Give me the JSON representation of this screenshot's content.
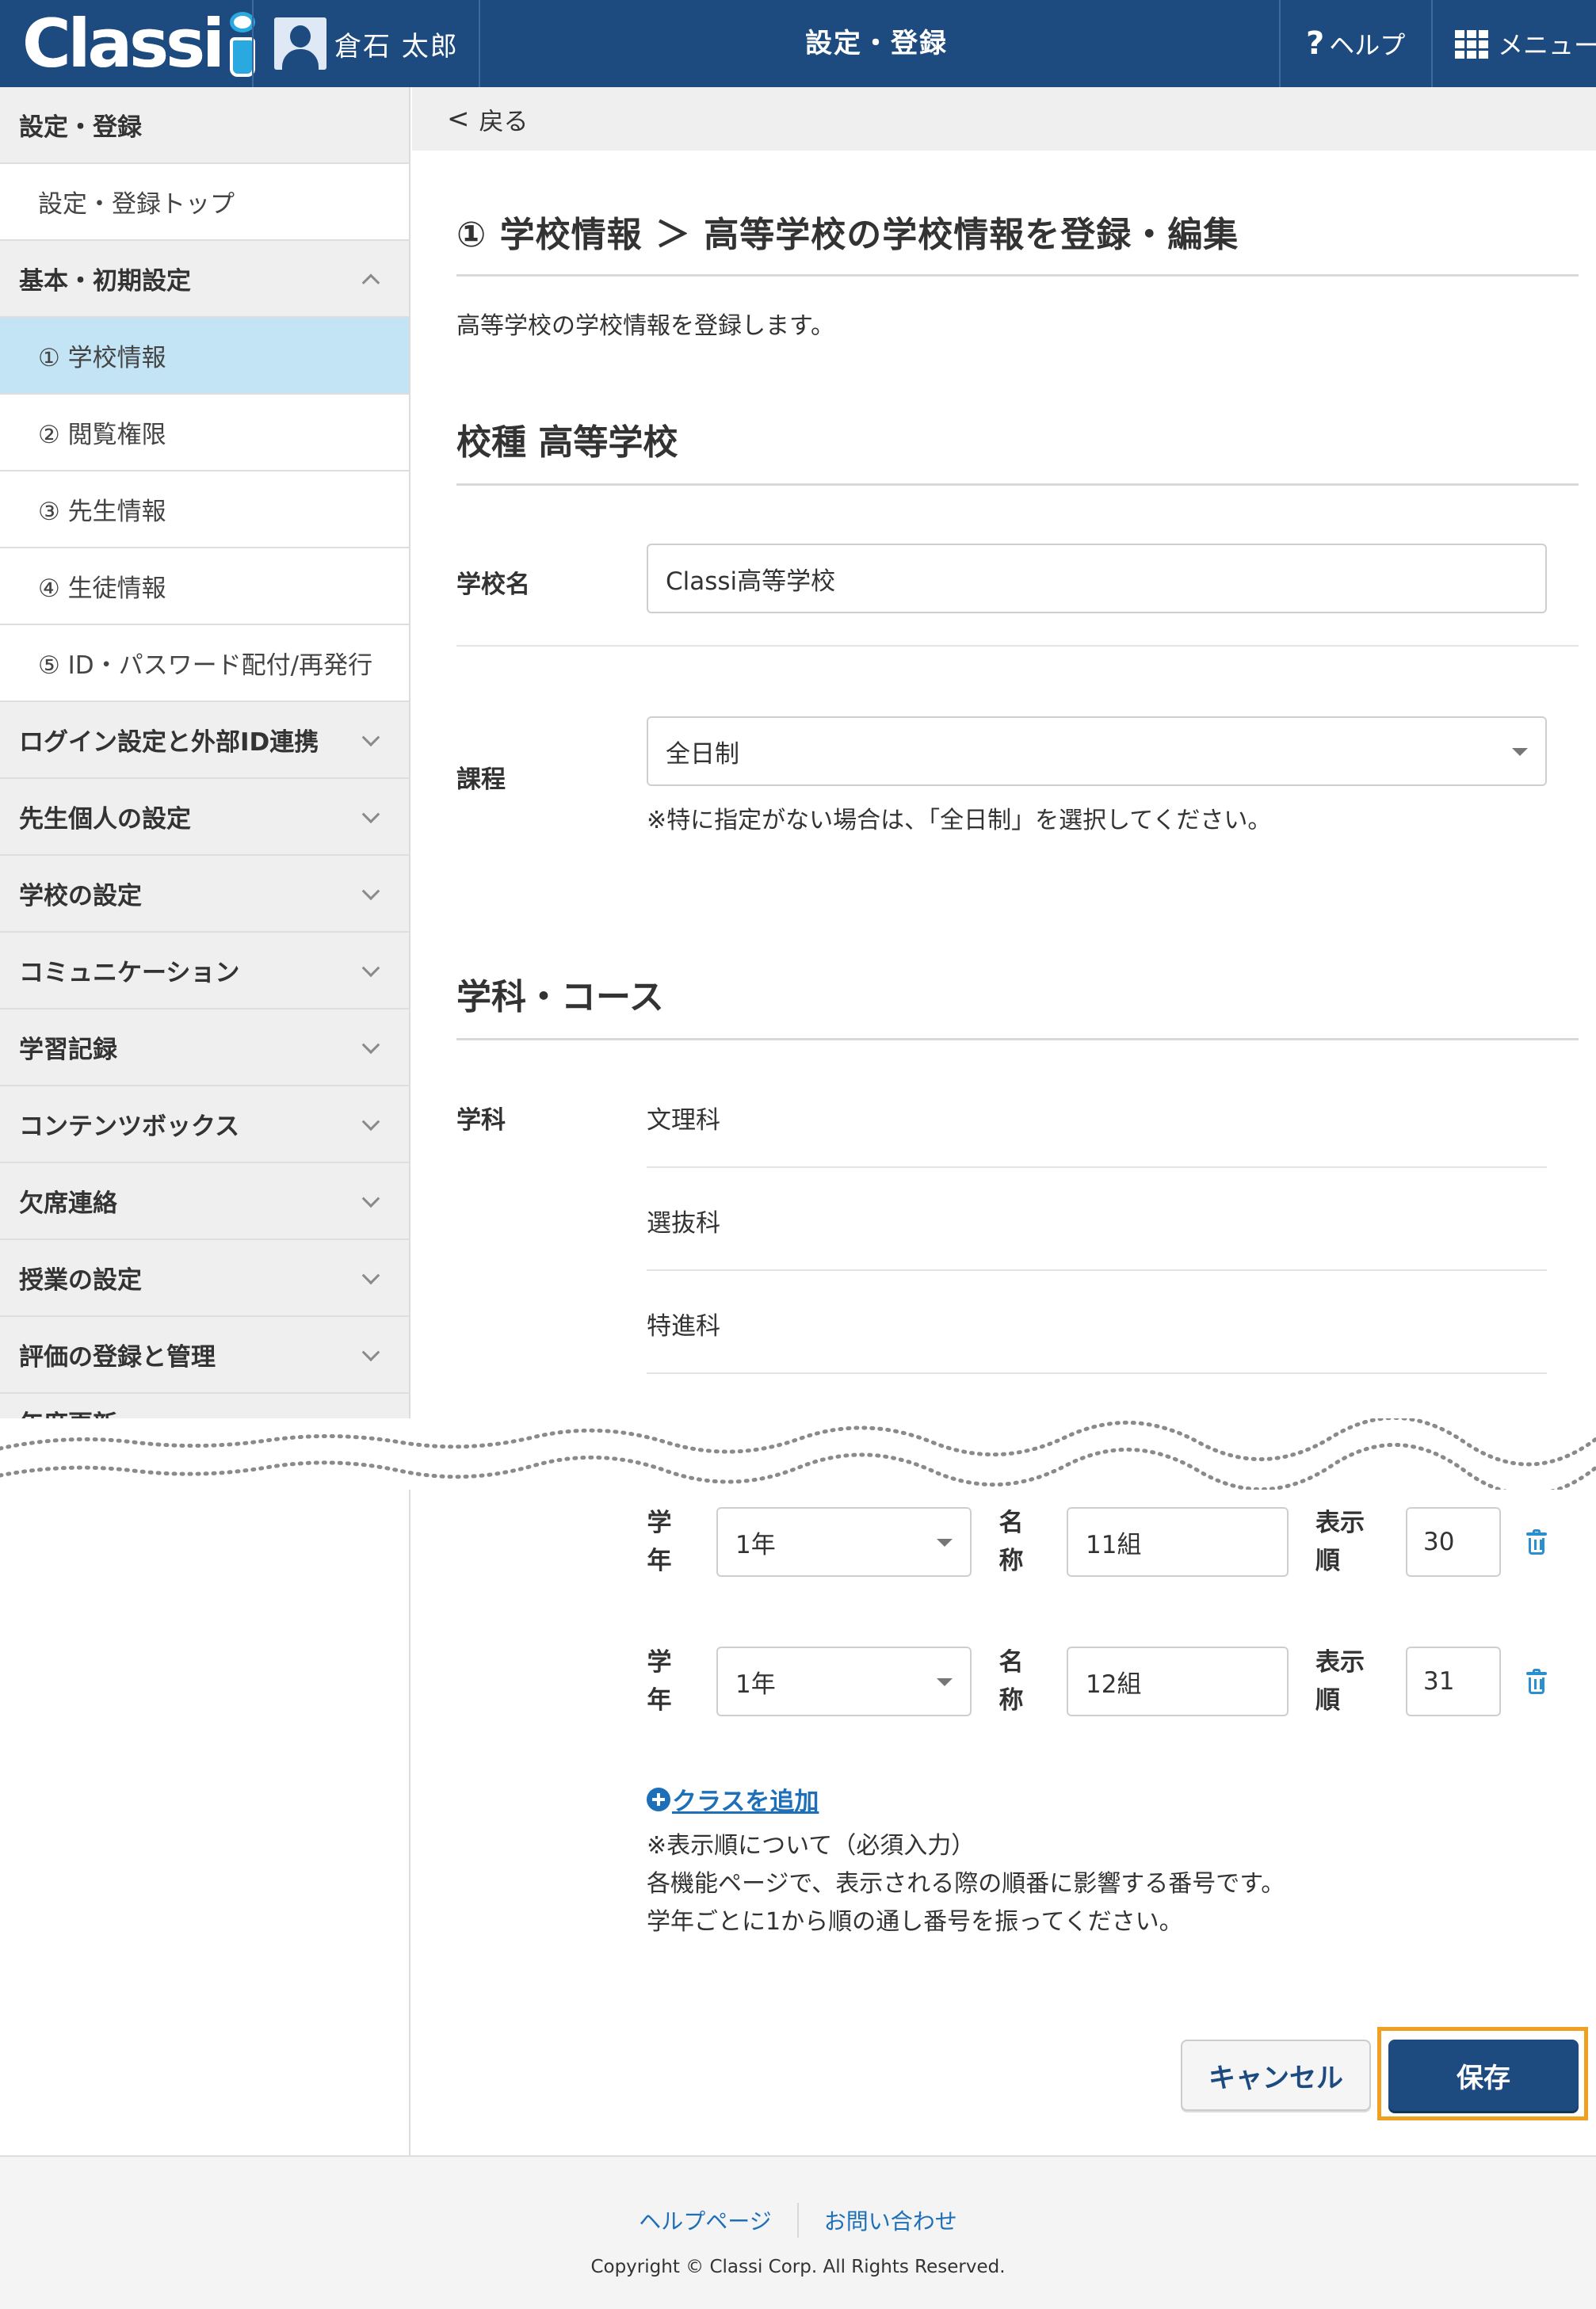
{
  "header": {
    "logo": "Classi",
    "user_name": "倉石 太郎",
    "title": "設定・登録",
    "help_label": "ヘルプ",
    "menu_label": "メニュー"
  },
  "sidebar": {
    "items": [
      {
        "label": "設定・登録",
        "type": "group"
      },
      {
        "label": "設定・登録トップ",
        "type": "item"
      },
      {
        "label": "基本・初期設定",
        "type": "group",
        "expanded": true
      },
      {
        "label": "① 学校情報",
        "type": "item",
        "active": true
      },
      {
        "label": "② 閲覧権限",
        "type": "item"
      },
      {
        "label": "③ 先生情報",
        "type": "item"
      },
      {
        "label": "④ 生徒情報",
        "type": "item"
      },
      {
        "label": "⑤ ID・パスワード配付/再発行",
        "type": "item"
      },
      {
        "label": "ログイン設定と外部ID連携",
        "type": "group"
      },
      {
        "label": "先生個人の設定",
        "type": "group"
      },
      {
        "label": "学校の設定",
        "type": "group"
      },
      {
        "label": "コミュニケーション",
        "type": "group"
      },
      {
        "label": "学習記録",
        "type": "group"
      },
      {
        "label": "コンテンツボックス",
        "type": "group"
      },
      {
        "label": "欠席連絡",
        "type": "group"
      },
      {
        "label": "授業の設定",
        "type": "group"
      },
      {
        "label": "評価の登録と管理",
        "type": "group"
      },
      {
        "label": "年度更新",
        "type": "group"
      }
    ]
  },
  "back_label": "戻る",
  "page": {
    "title": "① 学校情報 ＞ 高等学校の学校情報を登録・編集",
    "description": "高等学校の学校情報を登録します。",
    "school_type_heading": "校種 高等学校",
    "school_name_label": "学校名",
    "school_name_value": "Classi高等学校",
    "course_label": "課程",
    "course_value": "全日制",
    "course_note": "※特に指定がない場合は、「全日制」を選択してください。",
    "dept_heading": "学科・コース",
    "dept_label": "学科",
    "departments": [
      "文理科",
      "選抜科",
      "特進科"
    ]
  },
  "classes": {
    "grade_label_1": "学",
    "grade_label_2": "年",
    "name_label_1": "名",
    "name_label_2": "称",
    "order_label_1": "表示",
    "order_label_2": "順",
    "rows": [
      {
        "grade": "1年",
        "name": "11組",
        "order": "30"
      },
      {
        "grade": "1年",
        "name": "12組",
        "order": "31"
      }
    ],
    "add_label": "クラスを追加",
    "notes": [
      "※表示順について（必須入力）",
      "各機能ページで、表示される際の順番に影響する番号です。",
      "学年ごとに1から順の通し番号を振ってください。"
    ]
  },
  "buttons": {
    "cancel": "キャンセル",
    "save": "保存"
  },
  "footer": {
    "help_page": "ヘルプページ",
    "contact": "お問い合わせ",
    "copyright": "Copyright © Classi Corp. All Rights Reserved."
  },
  "colors": {
    "header_bg": "#1d4b80",
    "active_item_bg": "#c3e4f5",
    "link": "#1c6fb8",
    "highlight_frame": "#f0a020"
  }
}
